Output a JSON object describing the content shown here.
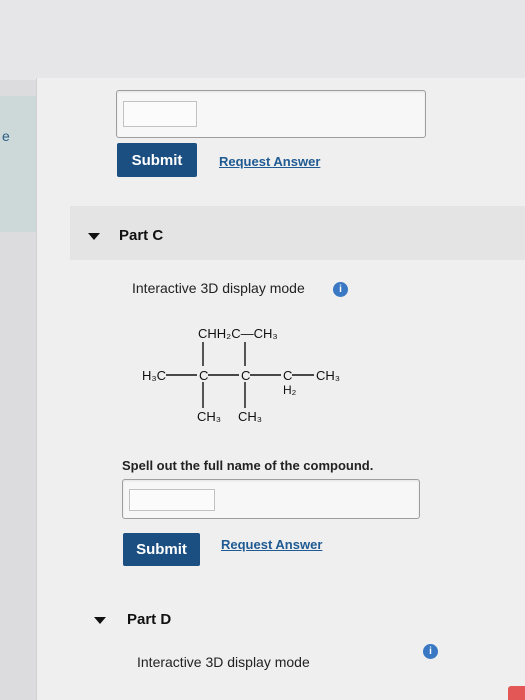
{
  "part_b": {
    "submit_label": "Submit",
    "request_answer_label": "Request Answer"
  },
  "part_c": {
    "title": "Part C",
    "display_mode_label": "Interactive 3D display mode",
    "info_icon_glyph": "i",
    "structure_labels": {
      "top": "CHH₂C—CH₃",
      "h3c": "H₃C",
      "c": "C",
      "ch3": "CH₃",
      "h2": "H₂"
    },
    "question": "Spell out the full name of the compound.",
    "answer_value": "",
    "submit_label": "Submit",
    "request_answer_label": "Request Answer"
  },
  "part_d": {
    "title": "Part D",
    "display_mode_label": "Interactive 3D display mode"
  },
  "left_edge_glyph": "e",
  "colors": {
    "submit_bg": "#1b4f82",
    "link": "#1f5a92",
    "info": "#3a78c4"
  }
}
